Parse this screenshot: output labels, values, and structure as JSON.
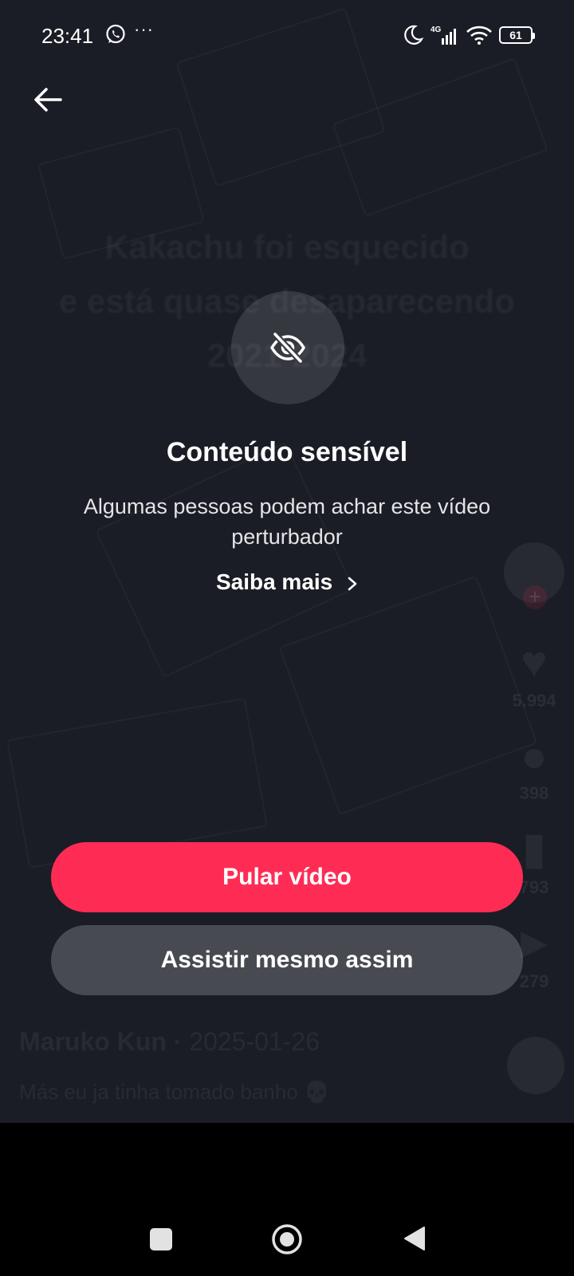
{
  "status_bar": {
    "time": "23:41",
    "overflow": "···",
    "network": "4G",
    "battery": "61",
    "icons": [
      "whatsapp-icon",
      "moon-icon",
      "signal-icon",
      "wifi-icon",
      "battery-icon"
    ]
  },
  "background": {
    "caption_lines": [
      "Kakachu foi esquecido",
      "e está quase desaparecendo",
      "2021-2024"
    ],
    "counts": {
      "likes": "5.994",
      "comments": "398",
      "saves": "793",
      "shares": "279"
    },
    "author": "Maruko Kun",
    "author_sep": " · ",
    "date": "2025-01-26",
    "description": "Más eu ja tinha tomado banho 💀"
  },
  "warning": {
    "icon": "eye-slash-icon",
    "title": "Conteúdo sensível",
    "description": "Algumas pessoas podem achar este vídeo perturbador",
    "learn_more": "Saiba mais"
  },
  "actions": {
    "skip_label": "Pular vídeo",
    "watch_label": "Assistir mesmo assim"
  },
  "colors": {
    "accent": "#fe2c55",
    "background": "#1b1d26"
  }
}
